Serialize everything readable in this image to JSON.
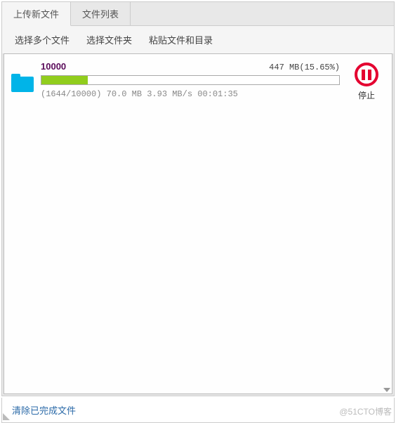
{
  "tabs": {
    "upload": "上传新文件",
    "list": "文件列表"
  },
  "toolbar": {
    "select_files": "选择多个文件",
    "select_folder": "选择文件夹",
    "paste": "粘贴文件和目录"
  },
  "item": {
    "name": "10000",
    "size_text": "447 MB",
    "percent_text": "(15.65%)",
    "percent_value": 15.65,
    "stats": "(1644/10000) 70.0 MB 3.93 MB/s 00:01:35",
    "stop_label": "停止"
  },
  "footer": {
    "clear": "清除已完成文件"
  },
  "watermark": "@51CTO博客"
}
